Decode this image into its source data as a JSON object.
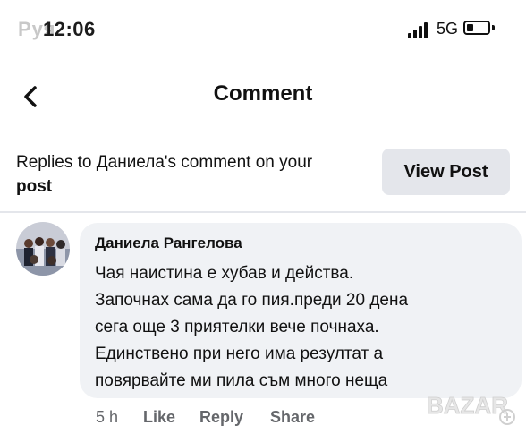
{
  "status_bar": {
    "overlay_text": "Руя",
    "time": "12:06",
    "network": "5G"
  },
  "header": {
    "title": "Comment",
    "back_icon": "chevron-left-icon"
  },
  "banner": {
    "text_prefix": "Replies to Даниела's comment on your",
    "text_bold": "post",
    "view_post_label": "View Post"
  },
  "comment": {
    "author": "Даниела Рангелова",
    "lines": [
      "Чая наистина е хубав и действа.",
      "Започнах сама да го пия.преди 20 дена",
      "сега още 3 приятелки вече почнаха.",
      "Единствено при него има резултат а",
      "повярвайте ми пила съм много неща"
    ],
    "timestamp": "5 h",
    "like_label": "Like",
    "reply_label": "Reply",
    "share_label": "Share"
  },
  "watermark": {
    "text": "BAZAR"
  },
  "colors": {
    "bubble_bg": "#f0f2f5",
    "button_bg": "#e4e6eb",
    "secondary_text": "#65676b"
  }
}
